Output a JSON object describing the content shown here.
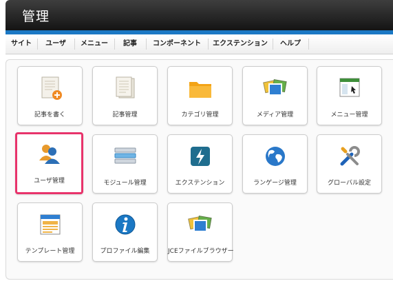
{
  "header": {
    "title": "管理"
  },
  "menu": [
    {
      "label": "サイト"
    },
    {
      "label": "ユーザ"
    },
    {
      "label": "メニュー"
    },
    {
      "label": "記事"
    },
    {
      "label": "コンポーネント"
    },
    {
      "label": "エクステンション"
    },
    {
      "label": "ヘルプ"
    }
  ],
  "tiles": [
    {
      "label": "記事を書く",
      "icon": "new-article-icon"
    },
    {
      "label": "記事管理",
      "icon": "article-manager-icon"
    },
    {
      "label": "カテゴリ管理",
      "icon": "folder-icon"
    },
    {
      "label": "メディア管理",
      "icon": "media-images-icon"
    },
    {
      "label": "メニュー管理",
      "icon": "menu-window-icon"
    },
    {
      "label": "ユーザ管理",
      "icon": "users-icon",
      "selected": true
    },
    {
      "label": "モジュール管理",
      "icon": "modules-stack-icon"
    },
    {
      "label": "エクステンション",
      "icon": "lightning-icon"
    },
    {
      "label": "ランゲージ管理",
      "icon": "globe-icon"
    },
    {
      "label": "グローバル設定",
      "icon": "tools-icon"
    },
    {
      "label": "テンプレート管理",
      "icon": "template-icon"
    },
    {
      "label": "プロファイル編集",
      "icon": "info-icon"
    },
    {
      "label": "JCEファイルブラウザー",
      "icon": "file-browser-icon"
    }
  ],
  "colors": {
    "accent": "#1b78c4",
    "highlight": "#e8336b"
  }
}
